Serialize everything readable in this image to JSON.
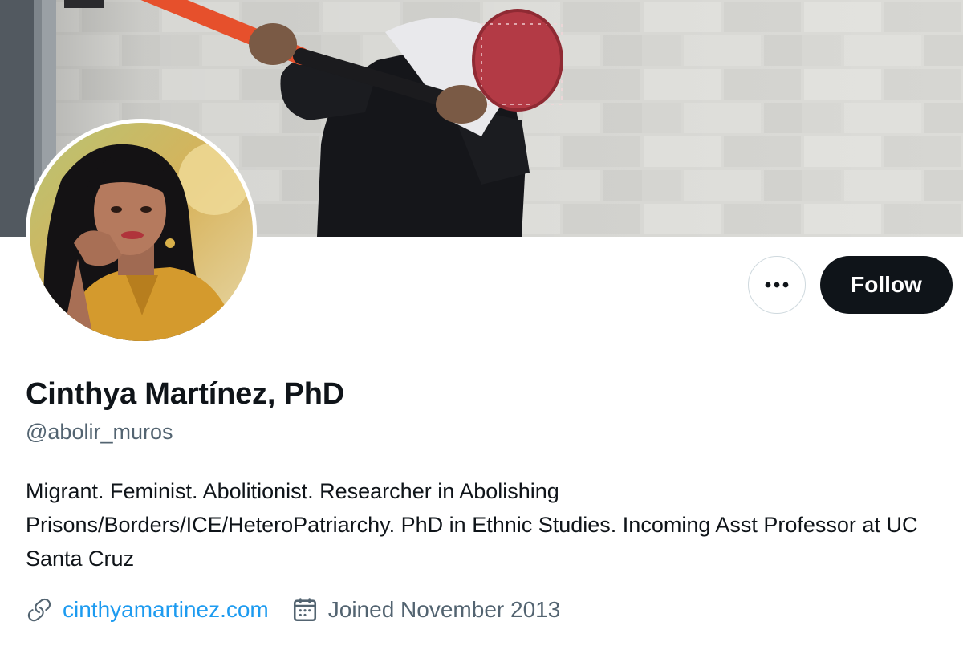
{
  "profile": {
    "display_name": "Cinthya Martínez, PhD",
    "handle": "@abolir_muros",
    "bio": "Migrant. Feminist. Abolitionist. Researcher in Abolishing Prisons/Borders/ICE/HeteroPatriarchy. PhD in Ethnic Studies. Incoming Asst Professor at UC Santa Cruz",
    "website": "cinthyamartinez.com",
    "joined": "Joined November 2013"
  },
  "actions": {
    "follow_label": "Follow"
  },
  "icons": {
    "more": "more-horizontal-icon",
    "link": "link-icon",
    "calendar": "calendar-icon"
  },
  "colors": {
    "primary_text": "#0f1419",
    "secondary_text": "#536471",
    "link": "#1d9bf0",
    "follow_button_bg": "#0f1419",
    "button_border": "#cfd9de"
  }
}
